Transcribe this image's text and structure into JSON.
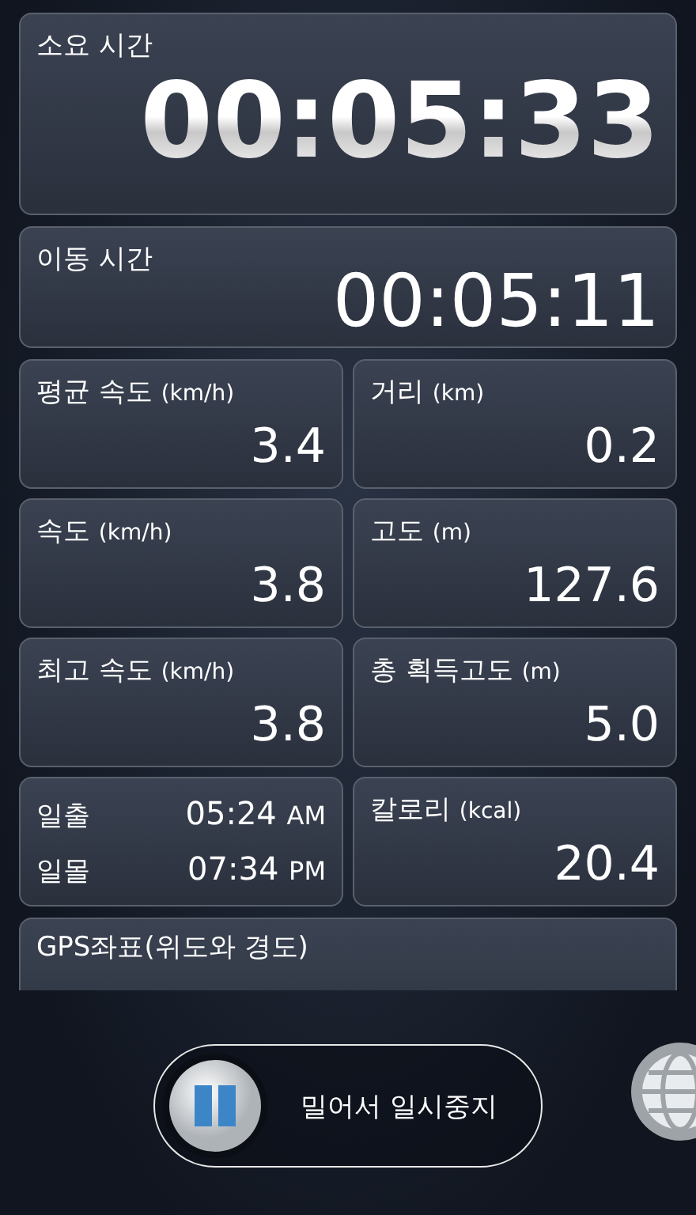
{
  "timers": [
    {
      "label": "소요 시간",
      "value": "00:05:33",
      "kind": "glossy"
    },
    {
      "label": "이동 시간",
      "value": "00:05:11",
      "kind": "plain"
    }
  ],
  "stats": [
    {
      "kind": "stat",
      "label": "평균 속도",
      "unit": "(km/h)",
      "value": "3.4"
    },
    {
      "kind": "stat",
      "label": "거리",
      "unit": "(km)",
      "value": "0.2"
    },
    {
      "kind": "stat",
      "label": "속도",
      "unit": "(km/h)",
      "value": "3.8"
    },
    {
      "kind": "stat",
      "label": "고도",
      "unit": "(m)",
      "value": "127.6"
    },
    {
      "kind": "stat",
      "label": "최고 속도",
      "unit": "(km/h)",
      "value": "3.8"
    },
    {
      "kind": "stat",
      "label": "총 획득고도",
      "unit": "(m)",
      "value": "5.0"
    },
    {
      "kind": "sun",
      "rows": [
        {
          "label": "일출",
          "time": "05:24",
          "period": "AM"
        },
        {
          "label": "일몰",
          "time": "07:34",
          "period": "PM"
        }
      ]
    },
    {
      "kind": "stat",
      "label": "칼로리",
      "unit": "(kcal)",
      "value": "20.4"
    }
  ],
  "gps": {
    "label": "GPS좌표(위도와 경도)"
  },
  "slider": {
    "label": "밀어서 일시중지"
  }
}
